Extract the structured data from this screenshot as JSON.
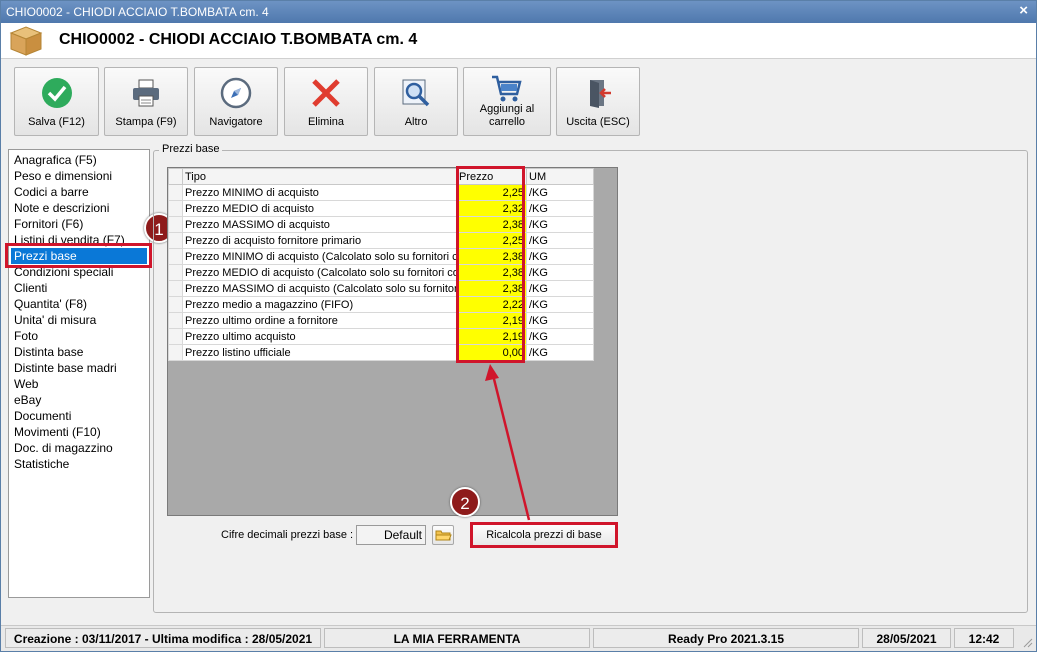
{
  "window": {
    "title": "CHIO0002 - CHIODI ACCIAIO T.BOMBATA cm. 4",
    "close_glyph": "×"
  },
  "header": {
    "title": "CHIO0002 - CHIODI ACCIAIO T.BOMBATA cm. 4",
    "icon": "box-icon"
  },
  "toolbar": {
    "buttons": [
      {
        "label": "Salva (F12)",
        "icon": "check-icon"
      },
      {
        "label": "Stampa (F9)",
        "icon": "printer-icon"
      },
      {
        "label": "Navigatore",
        "icon": "compass-icon"
      },
      {
        "label": "Elimina",
        "icon": "delete-x-icon"
      },
      {
        "label": "Altro",
        "icon": "magnifier-icon"
      },
      {
        "label": "Aggiungi al carrello",
        "icon": "cart-icon"
      },
      {
        "label": "Uscita (ESC)",
        "icon": "exit-door-icon"
      }
    ]
  },
  "nav": {
    "items": [
      "Anagrafica (F5)",
      "Peso e dimensioni",
      "Codici a barre",
      "Note e descrizioni",
      "Fornitori (F6)",
      "Listini di vendita (F7)",
      "Prezzi base",
      "Condizioni speciali",
      "Clienti",
      "Quantita' (F8)",
      "Unita' di misura",
      "Foto",
      "Distinta base",
      "Distinte base madri",
      "Web",
      "eBay",
      "Documenti",
      "Movimenti (F10)",
      "Doc. di magazzino",
      "Statistiche"
    ],
    "selected": "Prezzi base"
  },
  "annotations": {
    "badge1": "1",
    "badge2": "2",
    "highlight_color": "#d0152b"
  },
  "prezzi_base": {
    "group_label": "Prezzi base",
    "columns": {
      "tipo": "Tipo",
      "prezzo": "Prezzo",
      "um": "UM"
    },
    "rows": [
      {
        "tipo": "Prezzo MINIMO di acquisto",
        "prezzo": "2,25",
        "um": "/KG"
      },
      {
        "tipo": "Prezzo MEDIO di acquisto",
        "prezzo": "2,32",
        "um": "/KG"
      },
      {
        "tipo": "Prezzo MASSIMO di acquisto",
        "prezzo": "2,38",
        "um": "/KG"
      },
      {
        "tipo": "Prezzo di acquisto fornitore primario",
        "prezzo": "2,25",
        "um": "/KG"
      },
      {
        "tipo": "Prezzo MINIMO di acquisto (Calcolato solo su fornitori con",
        "prezzo": "2,38",
        "um": "/KG"
      },
      {
        "tipo": "Prezzo MEDIO di acquisto (Calcolato solo su fornitori con",
        "prezzo": "2,38",
        "um": "/KG"
      },
      {
        "tipo": "Prezzo MASSIMO di acquisto (Calcolato solo su fornitori c",
        "prezzo": "2,38",
        "um": "/KG"
      },
      {
        "tipo": "Prezzo medio a magazzino (FIFO)",
        "prezzo": "2,22",
        "um": "/KG"
      },
      {
        "tipo": "Prezzo ultimo ordine a fornitore",
        "prezzo": "2,19",
        "um": "/KG"
      },
      {
        "tipo": "Prezzo ultimo acquisto",
        "prezzo": "2,19",
        "um": "/KG"
      },
      {
        "tipo": "Prezzo listino ufficiale",
        "prezzo": "0,00",
        "um": "/KG"
      }
    ],
    "cifre_label": "Cifre decimali prezzi base :",
    "cifre_value": "Default",
    "ricalcola_label": "Ricalcola prezzi di base"
  },
  "statusbar": {
    "dates": "Creazione : 03/11/2017 - Ultima modifica : 28/05/2021",
    "company": "LA MIA FERRAMENTA",
    "product": "Ready Pro 2021.3.15",
    "date": "28/05/2021",
    "time": "12:42"
  }
}
